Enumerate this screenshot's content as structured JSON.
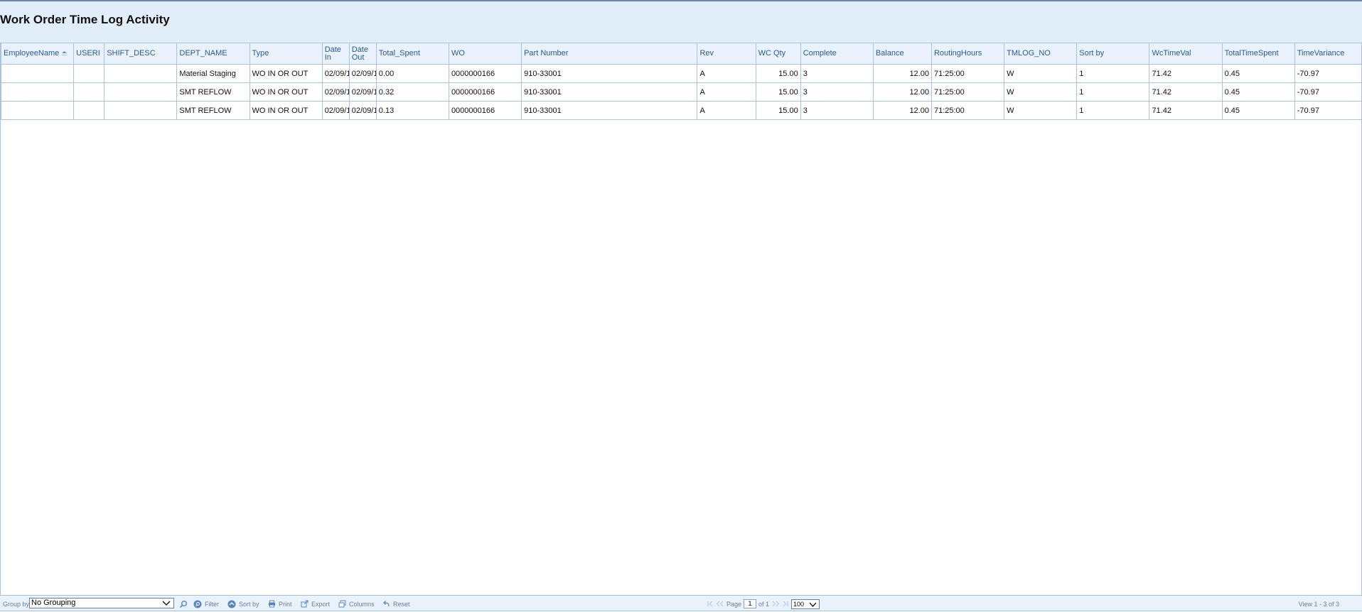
{
  "title": "Work Order Time Log Activity",
  "columns": [
    "EmployeeName",
    "USERI",
    "SHIFT_DESC",
    "DEPT_NAME",
    "Type",
    "Date In",
    "Date Out",
    "Total_Spent",
    "WO",
    "Part Number",
    "Rev",
    "WC Qty",
    "Complete",
    "Balance",
    "RoutingHours",
    "TMLOG_NO",
    "Sort by",
    "WcTimeVal",
    "TotalTimeSpent",
    "TimeVariance"
  ],
  "rows": [
    {
      "employee": "",
      "useri": "",
      "shift": "",
      "dept": "Material Staging",
      "type": "WO IN OR OUT",
      "date_in": "02/09/1",
      "date_out": "02/09/1",
      "total_spent": "0.00",
      "wo": "0000000166",
      "part": "910-33001",
      "rev": "A",
      "wc_qty": "15.00",
      "complete": "3",
      "balance": "12.00",
      "routing_hours": "71:25:00",
      "tmlog_no": "W",
      "sort_by": "1",
      "wc_time_val": "71.42",
      "total_time_spent": "0.45",
      "time_variance": "-70.97"
    },
    {
      "employee": "",
      "useri": "",
      "shift": "",
      "dept": "SMT REFLOW",
      "type": "WO IN OR OUT",
      "date_in": "02/09/1",
      "date_out": "02/09/1",
      "total_spent": "0.32",
      "wo": "0000000166",
      "part": "910-33001",
      "rev": "A",
      "wc_qty": "15.00",
      "complete": "3",
      "balance": "12.00",
      "routing_hours": "71:25:00",
      "tmlog_no": "W",
      "sort_by": "1",
      "wc_time_val": "71.42",
      "total_time_spent": "0.45",
      "time_variance": "-70.97"
    },
    {
      "employee": "",
      "useri": "",
      "shift": "",
      "dept": "SMT REFLOW",
      "type": "WO IN OR OUT",
      "date_in": "02/09/1",
      "date_out": "02/09/1",
      "total_spent": "0.13",
      "wo": "0000000166",
      "part": "910-33001",
      "rev": "A",
      "wc_qty": "15.00",
      "complete": "3",
      "balance": "12.00",
      "routing_hours": "71:25:00",
      "tmlog_no": "W",
      "sort_by": "1",
      "wc_time_val": "71.42",
      "total_time_spent": "0.45",
      "time_variance": "-70.97"
    }
  ],
  "footer": {
    "group_by_label": "Group by:",
    "group_by_value": "No Grouping",
    "filter_label": "Filter",
    "sort_label": "Sort by",
    "print_label": "Print",
    "export_label": "Export",
    "columns_label": "Columns",
    "reset_label": "Reset",
    "page_label": "Page",
    "page_value": "1",
    "of_label": "of 1",
    "rows_per_page": "100",
    "view_text": "View 1 - 3 of 3"
  },
  "colors": {
    "header_bg": "#e9f2fc",
    "header_text": "#2b5a8e",
    "border": "#a9c3df",
    "title_bg": "#e2edfa"
  },
  "icons": [
    "sort-ascending-icon",
    "search-icon",
    "filter-icon",
    "sort-icon",
    "print-icon",
    "export-icon",
    "columns-icon",
    "reset-icon",
    "first-page-icon",
    "prev-page-icon",
    "next-page-icon",
    "last-page-icon",
    "chevron-down-icon"
  ]
}
